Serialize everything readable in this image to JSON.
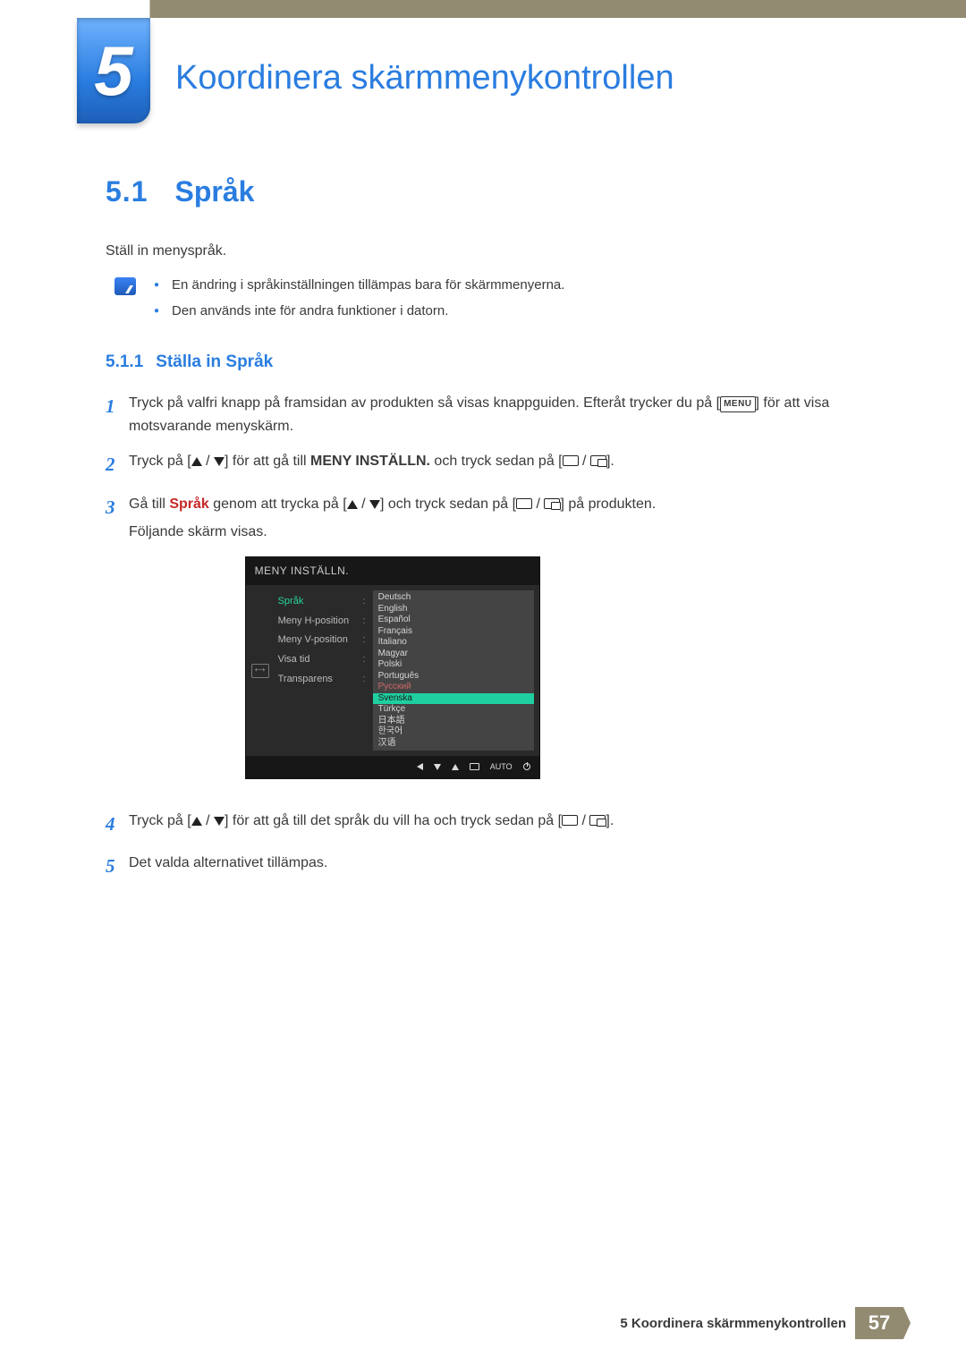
{
  "chapter": {
    "number": "5",
    "title": "Koordinera skärmmenykontrollen"
  },
  "section": {
    "number": "5.1",
    "title": "Språk"
  },
  "intro": "Ställ in menyspråk.",
  "notes": [
    "En ändring i språkinställningen tillämpas bara för skärmmenyerna.",
    "Den används inte för andra funktioner i datorn."
  ],
  "subsection": {
    "number": "5.1.1",
    "title": "Ställa in Språk"
  },
  "steps": {
    "s1a": "Tryck på valfri knapp på framsidan av produkten så visas knappguiden. Efteråt trycker du på [",
    "menu": "MENU",
    "s1b": "] för att visa motsvarande menyskärm.",
    "s2a": "Tryck på [",
    "s2b": "] för att gå till ",
    "s2bold": "MENY INSTÄLLN.",
    "s2c": " och tryck sedan på [",
    "s2d": "].",
    "s3a": "Gå till ",
    "s3red": "Språk",
    "s3b": " genom att trycka på [",
    "s3c": "] och tryck sedan på [",
    "s3d": "] på produkten.",
    "s3e": "Följande skärm visas.",
    "s4a": "Tryck på [",
    "s4b": "] för att gå till det språk du vill ha och tryck sedan på [",
    "s4c": "].",
    "s5": "Det valda alternativet tillämpas."
  },
  "osd": {
    "header": "MENY INSTÄLLN.",
    "menu": [
      "Språk",
      "Meny H-position",
      "Meny V-position",
      "Visa tid",
      "Transparens"
    ],
    "langs": [
      "Deutsch",
      "English",
      "Español",
      "Français",
      "Italiano",
      "Magyar",
      "Polski",
      "Português",
      "Русский",
      "Svenska",
      "Türkçe",
      "日本語",
      "한국어",
      "汉语"
    ],
    "selected": "Svenska",
    "keyword": "Русский",
    "auto": "AUTO"
  },
  "footer": {
    "text": "5 Koordinera skärmmenykontrollen",
    "page": "57"
  }
}
